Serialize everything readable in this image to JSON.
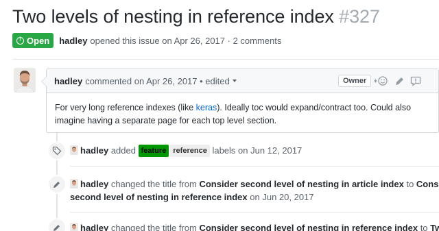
{
  "issue": {
    "title": "Two levels of nesting in reference index",
    "number": "#327",
    "state_label": "Open",
    "author": "hadley",
    "opened_text": "opened this issue on Apr 26, 2017 · 2 comments"
  },
  "comment": {
    "author": "hadley",
    "header_text": "commented on Apr 26, 2017 • edited",
    "owner_label": "Owner",
    "body_before": "For very long reference indexes (like ",
    "link_text": "keras",
    "body_after": "). Ideally toc would expand/contract too. Could also imagine having a separate page for each top level section."
  },
  "events": [
    {
      "icon": "tag-icon",
      "author": "hadley",
      "action": "added",
      "labels": [
        {
          "name": "feature",
          "color": "#009800"
        },
        {
          "name": "reference",
          "color": "#eeeeee"
        }
      ],
      "suffix": "labels on Jun 12, 2017"
    },
    {
      "icon": "pencil-icon",
      "author": "hadley",
      "text_a": "changed the title from",
      "from": "Consider second level of nesting in article index",
      "text_b": "to",
      "to_line1": "Consider",
      "to_line2": "second level of nesting in reference index",
      "date": "on Jun 20, 2017"
    },
    {
      "icon": "pencil-icon",
      "author": "hadley",
      "text_a": "changed the title from",
      "from": "Consider second level of nesting in reference index",
      "text_b": "to",
      "to_partial": "Two"
    }
  ],
  "colors": {
    "open_green": "#28a745",
    "link_blue": "#0366d6",
    "feature_label": "#009800"
  }
}
